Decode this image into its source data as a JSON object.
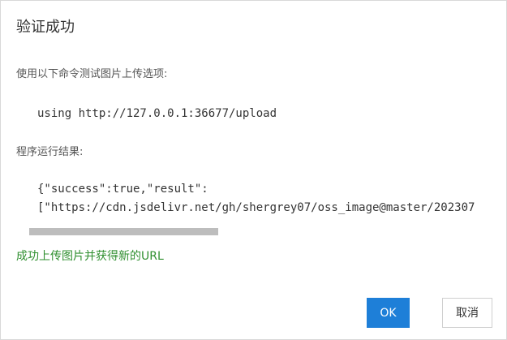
{
  "dialog": {
    "title": "验证成功",
    "test_command_label": "使用以下命令测试图片上传选项:",
    "test_command": "using http://127.0.0.1:36677/upload",
    "result_label": "程序运行结果:",
    "result_lines": [
      "{\"success\":true,\"result\":",
      "[\"https://cdn.jsdelivr.net/gh/shergrey07/oss_image@master/202307"
    ],
    "success_message": "成功上传图片并获得新的URL",
    "ok_label": "OK",
    "cancel_label": "取消"
  },
  "colors": {
    "success_text": "#2f8f2f",
    "primary_button": "#1e7fd8",
    "scrollbar_thumb": "#bdbdbd"
  }
}
